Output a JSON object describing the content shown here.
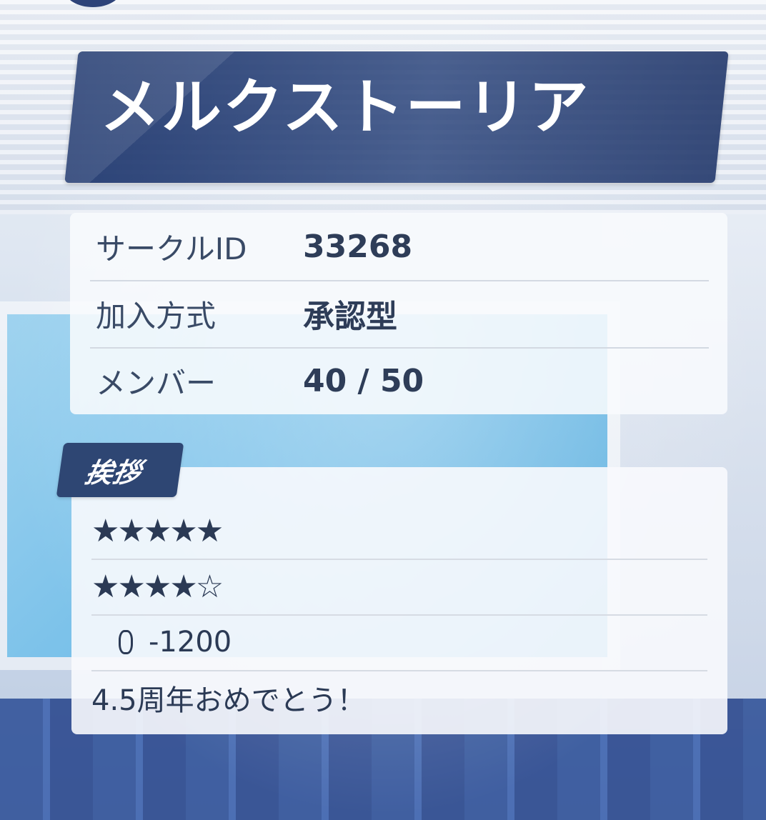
{
  "circle": {
    "name": "メルクストーリア"
  },
  "info": {
    "rows": [
      {
        "label": "サークルID",
        "value": "33268"
      },
      {
        "label": "加入方式",
        "value": "承認型"
      },
      {
        "label": "メンバー",
        "value": "40 / 50"
      }
    ]
  },
  "greeting": {
    "tab_label": "挨拶",
    "lines": [
      "★★★★★",
      "★★★★☆",
      "-1200",
      "4.5周年おめでとう！"
    ],
    "jewel_icon": "jewel-icon"
  },
  "colors": {
    "banner": "#223a70",
    "tab": "#2e4673",
    "text": "#2b3a55"
  }
}
